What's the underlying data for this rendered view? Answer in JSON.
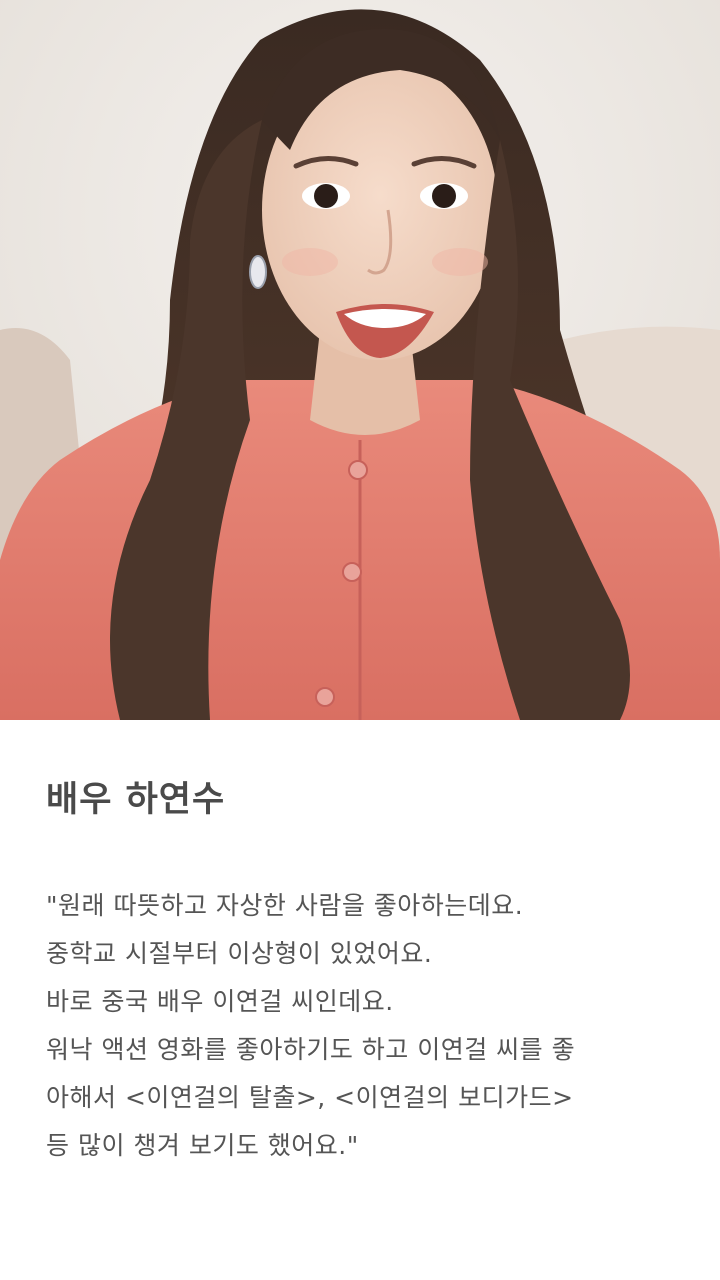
{
  "article": {
    "photo": {
      "alt": "하연수"
    },
    "title": "배우 하연수",
    "quote_lines": [
      "\"원래 따뜻하고 자상한 사람을 좋아하는데요.",
      "중학교 시절부터 이상형이 있었어요.",
      "바로 중국 배우 이연걸 씨인데요.",
      "워낙 액션 영화를 좋아하기도 하고 이연걸 씨를 좋",
      "아해서 <이연걸의 탈출>, <이연걸의 보디가드>",
      "등 많이 챙겨 보기도 했어요.\""
    ]
  },
  "colors": {
    "background": "#ffffff",
    "title": "#4a4a4a",
    "body_text": "#555555"
  }
}
